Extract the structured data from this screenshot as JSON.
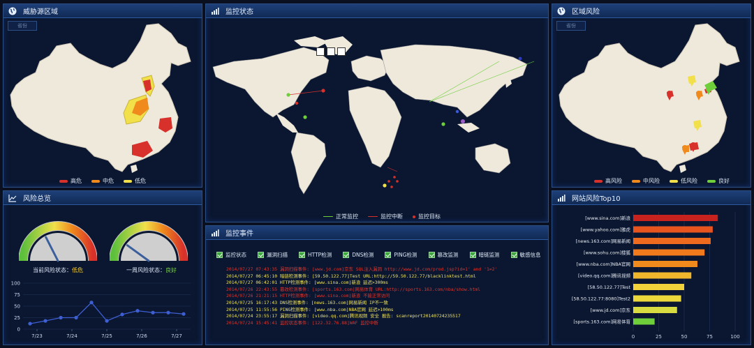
{
  "panels": {
    "threat_source": {
      "title": "威胁源区域",
      "button": "省份"
    },
    "monitor_status": {
      "title": "监控状态"
    },
    "region_risk": {
      "title": "区域风险",
      "button": "省份"
    },
    "risk_overview": {
      "title": "风险总览"
    },
    "monitor_events": {
      "title": "监控事件"
    },
    "site_risk": {
      "title": "网站风险Top10"
    }
  },
  "threat_legend": [
    {
      "label": "高危",
      "color": "#d8302a"
    },
    {
      "label": "中危",
      "color": "#f08a1c"
    },
    {
      "label": "低危",
      "color": "#f1e04a"
    }
  ],
  "region_legend": [
    {
      "label": "高风险",
      "color": "#d8302a"
    },
    {
      "label": "中风险",
      "color": "#f08a1c"
    },
    {
      "label": "低风险",
      "color": "#f1e04a"
    },
    {
      "label": "良好",
      "color": "#6fcf3a"
    }
  ],
  "world_legend": [
    {
      "label": "正常监控",
      "color": "#6fcf3a"
    },
    {
      "label": "监控中断",
      "color": "#d8302a"
    },
    {
      "label": "监控目标",
      "color": "#d8302a"
    }
  ],
  "gauges": {
    "current": {
      "label": "当前风险状态：",
      "value": "低危",
      "level": 0.35
    },
    "week": {
      "label": "一周风险状态：",
      "value": "良好",
      "level": 0.2
    }
  },
  "event_filters": [
    "监控状态",
    "漏洞扫描",
    "HTTP检测",
    "DNS检测",
    "PING检测",
    "篡改监测",
    "暗链监测",
    "敏感信息"
  ],
  "events": [
    {
      "text": "2014/07/27 07:43:35 漏洞扫描事件: [www.jd.com]京东 SQL注入漏洞 http://www.jd.com/prod.jsp?id=1' and '1=2'",
      "color": "red"
    },
    {
      "text": "2014/07/27 06:45:10 暗链检测事件: [59.50.122.77]Test URL:http://59.50.122.77/blacklinktest.html",
      "color": "yellow"
    },
    {
      "text": "2014/07/27 06:42:01 HTTP检测事件: [www.sina.com]新浪 延迟>300ms",
      "color": "yellow"
    },
    {
      "text": "2014/07/26 22:43:55 篡改检测事件: [sports.163.com]网易体育 URL:http://sports.163.com/nba/show.html",
      "color": "red"
    },
    {
      "text": "2014/07/26 21:21:15 HTTP检测事件: [www.sina.com]新浪 不能正常访问",
      "color": "red"
    },
    {
      "text": "2014/07/25 16:17:43 DNS检测事件: [news.163.com]网易新闻 IP不一致",
      "color": "yellow"
    },
    {
      "text": "2014/07/25 11:55:56 PING检测事件: [www.nba.com]NBA官网 延迟>100ms",
      "color": "yellow"
    },
    {
      "text": "2014/07/24 23:55:17 漏洞扫描事件: [video.qq.com]腾讯视频 安全 报告: scanreport20140724235517",
      "color": "yellow"
    },
    {
      "text": "2014/07/24 15:45:41 监控状态事件: [122.32.76.88]WAF 监控中断",
      "color": "red"
    }
  ],
  "chart_data": [
    {
      "type": "line",
      "x": [
        "7/23",
        "7/24",
        "7/25",
        "7/26",
        "7/27"
      ],
      "y_values": [
        12,
        18,
        25,
        25,
        58,
        18,
        32,
        40,
        36,
        36,
        33
      ],
      "ylim": [
        0,
        100
      ],
      "yticks": [
        0,
        25,
        50,
        75,
        100
      ]
    },
    {
      "type": "bar",
      "categories": [
        "[www.sina.com]新浪",
        "[www.yahoo.com]雅虎",
        "[news.163.com]网易新闻",
        "[www.sohu.com]搜狐",
        "[www.nba.com]NBA官网",
        "[video.qq.com]腾讯视频",
        "[58.50.122.77]Test",
        "[58.50.122.77:8080]Test2",
        "[www.jd.com]京东",
        "[sports.163.com]网易体育"
      ],
      "values": [
        83,
        78,
        76,
        70,
        63,
        57,
        50,
        47,
        43,
        21
      ],
      "colors": [
        "#c8221e",
        "#e8541e",
        "#ee6a1e",
        "#f07a1c",
        "#f08a1c",
        "#f0b62c",
        "#f2d23a",
        "#ecd83a",
        "#d8dc40",
        "#6fcf3a"
      ],
      "xlim": [
        0,
        100
      ],
      "xticks": [
        0,
        25,
        50,
        75,
        100
      ]
    }
  ]
}
